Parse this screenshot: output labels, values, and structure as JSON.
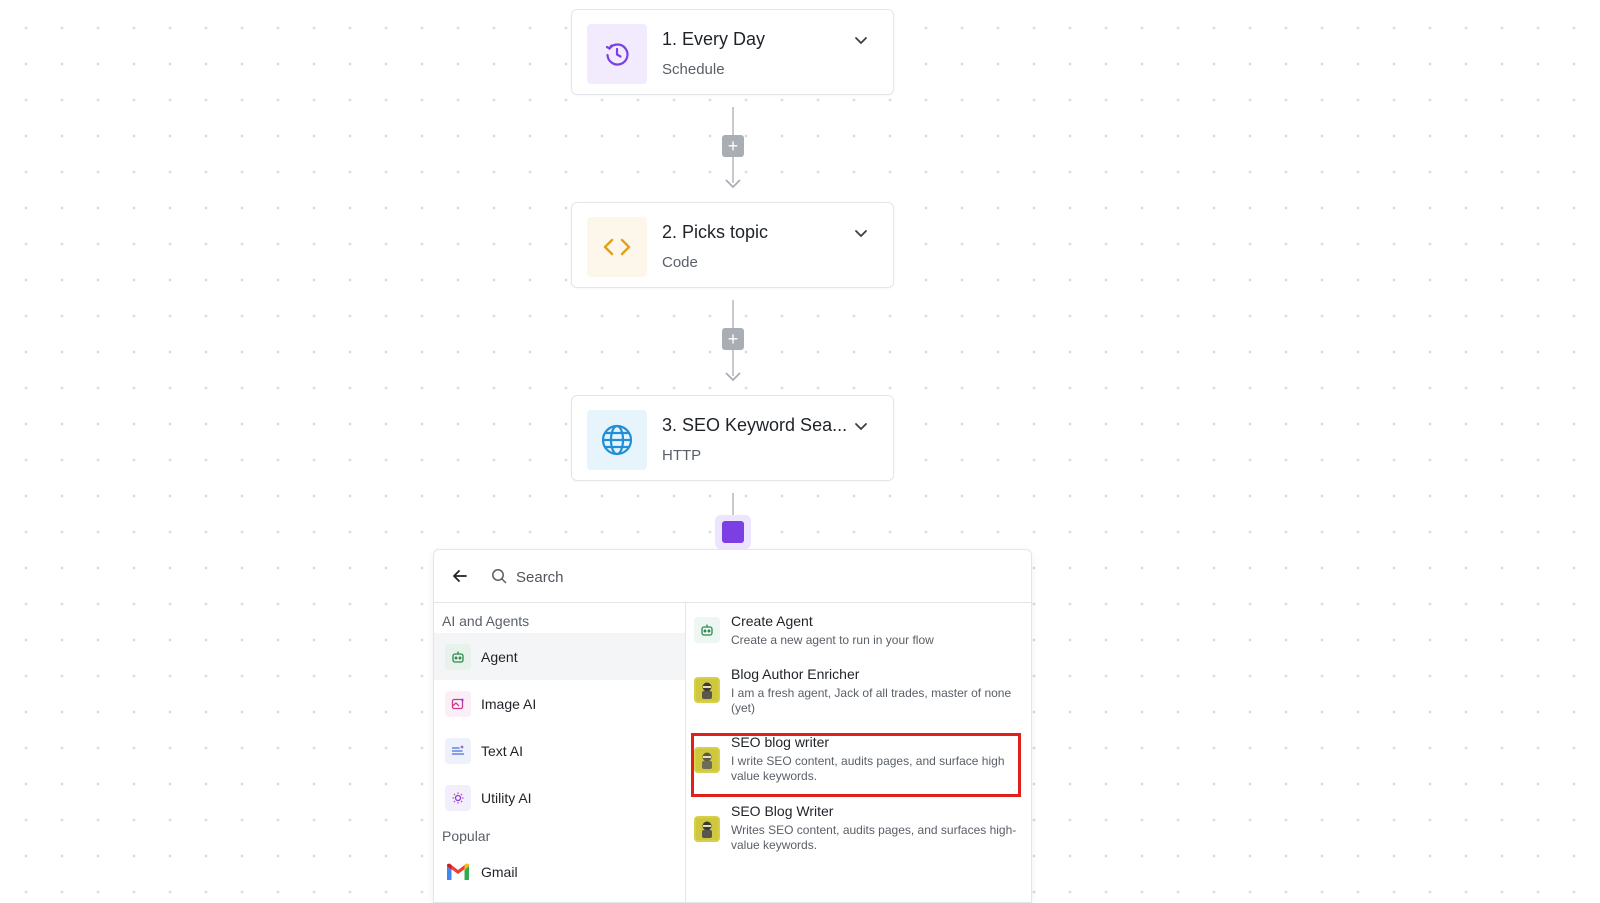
{
  "steps": [
    {
      "title": "1. Every Day",
      "subtitle": "Schedule",
      "icon": "schedule-icon",
      "tile_color": "#f1ebfd"
    },
    {
      "title": "2. Picks topic",
      "subtitle": "Code",
      "icon": "code-icon",
      "tile_color": "#fdf6ea"
    },
    {
      "title": "3. SEO Keyword Sea...",
      "subtitle": "HTTP",
      "icon": "globe-icon",
      "tile_color": "#e8f4fc"
    }
  ],
  "connector": {
    "plus": "+"
  },
  "picker": {
    "search_placeholder": "Search",
    "sections": {
      "ai_label": "AI and Agents",
      "popular_label": "Popular"
    },
    "categories": [
      {
        "label": "Agent",
        "icon": "robot-icon",
        "active": true
      },
      {
        "label": "Image AI",
        "icon": "image-ai-icon",
        "active": false
      },
      {
        "label": "Text AI",
        "icon": "text-ai-icon",
        "active": false
      },
      {
        "label": "Utility AI",
        "icon": "utility-ai-icon",
        "active": false
      }
    ],
    "popular": [
      {
        "label": "Gmail",
        "icon": "gmail-icon"
      }
    ],
    "items": [
      {
        "title": "Create Agent",
        "description": "Create a new agent to run in your flow",
        "icon": "robot-icon"
      },
      {
        "title": "Blog Author Enricher",
        "description": "I am a fresh agent, Jack of all trades, master of none (yet)",
        "icon": "agent-avatar-icon"
      },
      {
        "title": "SEO blog writer",
        "description": "I write SEO content, audits pages, and surface high value keywords.",
        "icon": "agent-avatar-icon",
        "highlighted": true
      },
      {
        "title": "SEO Blog Writer",
        "description": "Writes SEO content, audits pages, and surfaces high-value keywords.",
        "icon": "agent-avatar-icon"
      }
    ]
  },
  "colors": {
    "accent": "#7b3fe4",
    "highlight": "#e0211b"
  }
}
